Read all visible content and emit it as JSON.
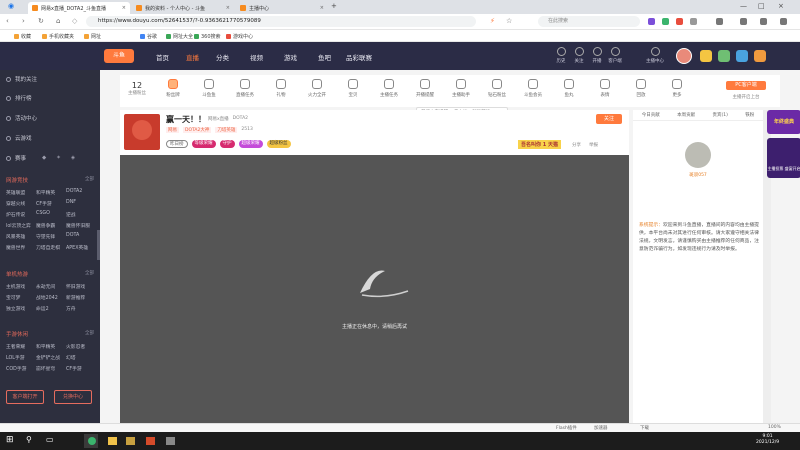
{
  "browser": {
    "tabs": [
      {
        "title": "网易x直播_DOTA2_斗鱼直播",
        "active": true
      },
      {
        "title": "我的资料 - 个人中心 - 斗鱼",
        "active": false
      },
      {
        "title": "主播中心",
        "active": false
      }
    ],
    "new_tab": "+",
    "url": "https://www.douyu.com/52641537/?-0.9363621770579089",
    "search_placeholder": "在此搜索",
    "bookmarks": [
      "收藏",
      "手机收藏夹",
      "网址",
      "谷歌",
      "网址大全",
      "360搜索",
      "游戏中心"
    ]
  },
  "site": {
    "nav": [
      "首页",
      "直播",
      "分类",
      "视频",
      "游戏",
      "鱼吧",
      "品彩联赛"
    ],
    "active_nav": "直播",
    "header_icons": [
      "历史",
      "关注",
      "开播",
      "客户端",
      "主播中心"
    ]
  },
  "sidebar": {
    "top_items": [
      "我的关注",
      "排行榜",
      "活动中心",
      "云游戏"
    ],
    "extra_label": "赛事",
    "sections": [
      {
        "title": "网游竞技",
        "more": "全部",
        "items": [
          "英雄联盟",
          "和平精英",
          "DOTA2",
          "穿越火线",
          "CF手游",
          "DNF",
          "炉石传说",
          "CSGO",
          "逆战",
          "lol云顶之弈",
          "魔兽争霸",
          "魔兽怀旧服",
          "风暴英雄",
          "守望先锋",
          "DOTA",
          "魔兽世界",
          "刀塔自走棋",
          "APEX英雄"
        ]
      },
      {
        "title": "单机热游",
        "more": "全部",
        "items": [
          "主机游戏",
          "永劫无间",
          "怀旧游戏",
          "宝可梦",
          "战地2042",
          "新游推荐",
          "独立游戏",
          "命运2",
          "方舟"
        ]
      },
      {
        "title": "手游休闲",
        "more": "全部",
        "items": [
          "王者荣耀",
          "和平精英",
          "火影忍者",
          "LOL手游",
          "金铲铲之战",
          "幻塔",
          "COD手游",
          "崩坏星穹",
          "CF手游"
        ]
      }
    ],
    "buttons": [
      "客户端打开",
      "兑换中心"
    ]
  },
  "toolbar": {
    "count": "12",
    "count_label": "主播粉丝",
    "items": [
      "粉丝牌",
      "斗鱼鱼",
      "直播任务",
      "礼物",
      "火力全开",
      "宝贝",
      "主播任务",
      "开播提醒",
      "主播助手",
      "钻石粉丝",
      "斗鱼会员",
      "鱼丸",
      "表情",
      "回放",
      "更多"
    ],
    "tooltip_left": "开播上车提醒",
    "tooltip_right": "看大地一起玩游戏",
    "pc_btn": "PC客户端",
    "pc_sub": "主播开启上台"
  },
  "room": {
    "title": "赢一天！！",
    "category": "DOTA2",
    "streamer": "网易x直播",
    "tags": [
      "网易",
      "DOTA2大神",
      "刀塔英雄"
    ],
    "badges": [
      "等级荣耀",
      "守护",
      "超级荣耀",
      "超级粉丝"
    ],
    "fans": "2513",
    "rank_label": "昨日榜",
    "follow_btn": "关注",
    "promo_badge": "吾名叫你 1 天猫",
    "share": "分享",
    "report": "举报"
  },
  "player": {
    "offline_text": "主播正在休息中，请稍后再试"
  },
  "right_panel": {
    "tabs": [
      "今日贡献",
      "本周贡献",
      "贵宾(1)",
      "铁粉"
    ],
    "user": "斑驳057",
    "notice_label": "系统提示：",
    "notice": "欢迎来到斗鱼直播，直播间的内容均由主播提供，本平台尚未对其进行任何审核。请大家遵守相关法律法规，文明发言。请谨慎购买由主播推荐的任何商品，注意防范诈骗行为。如发现违规行为请及时举报。"
  },
  "right_promo": {
    "title": "年终盛典",
    "subtitle": "主播投票 盛宴开启"
  },
  "statusbar": {
    "items": [
      "Flash插件",
      "加速器",
      "下载",
      "100%"
    ]
  },
  "taskbar": {
    "time": "9:01",
    "date": "2021/12/9",
    "icons": [
      "start-icon",
      "search-icon",
      "taskview-icon",
      "360-icon",
      "folder-icon",
      "game-icon",
      "app-icon"
    ]
  },
  "colors": {
    "header": "#2b2c46",
    "accent": "#ff7a3d",
    "sidebar": "#2d2f3e"
  }
}
